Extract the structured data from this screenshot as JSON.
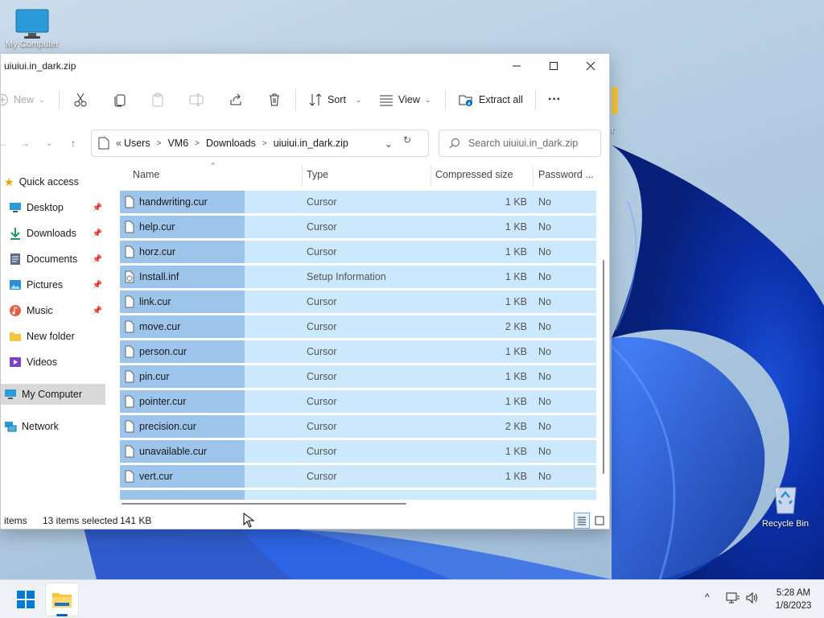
{
  "desktop": {
    "icons": [
      {
        "label": "My Computer"
      },
      {
        "label": "Recycle Bin"
      }
    ],
    "edge_letter": "r"
  },
  "window": {
    "title": "uiuiui.in_dark.zip",
    "controls": {
      "minimize": "—",
      "maximize": "☐",
      "close": "✕"
    }
  },
  "toolbar": {
    "new_label": "New",
    "sort_label": "Sort",
    "view_label": "View",
    "extract_label": "Extract all",
    "more_label": "···"
  },
  "address": {
    "prefix": "«",
    "crumbs": [
      "Users",
      "VM6",
      "Downloads",
      "uiuiui.in_dark.zip"
    ],
    "search_placeholder": "Search uiuiui.in_dark.zip"
  },
  "navpane": {
    "items": [
      {
        "label": "Quick access",
        "icon": "star-icon",
        "pinned": false
      },
      {
        "label": "Desktop",
        "icon": "desktop-icon",
        "pinned": true
      },
      {
        "label": "Downloads",
        "icon": "download-icon",
        "pinned": true
      },
      {
        "label": "Documents",
        "icon": "documents-icon",
        "pinned": true
      },
      {
        "label": "Pictures",
        "icon": "pictures-icon",
        "pinned": true
      },
      {
        "label": "Music",
        "icon": "music-icon",
        "pinned": true
      },
      {
        "label": "New folder",
        "icon": "folder-icon",
        "pinned": false
      },
      {
        "label": "Videos",
        "icon": "videos-icon",
        "pinned": false
      },
      {
        "label": "My Computer",
        "icon": "computer-icon",
        "pinned": false
      },
      {
        "label": "Network",
        "icon": "network-icon",
        "pinned": false
      }
    ]
  },
  "filelist": {
    "columns": [
      "Name",
      "Type",
      "Compressed size",
      "Password ..."
    ],
    "rows": [
      {
        "name": "handwriting.cur",
        "type": "Cursor",
        "size": "1 KB",
        "password": "No"
      },
      {
        "name": "help.cur",
        "type": "Cursor",
        "size": "1 KB",
        "password": "No"
      },
      {
        "name": "horz.cur",
        "type": "Cursor",
        "size": "1 KB",
        "password": "No"
      },
      {
        "name": "Install.inf",
        "type": "Setup Information",
        "size": "1 KB",
        "password": "No"
      },
      {
        "name": "link.cur",
        "type": "Cursor",
        "size": "1 KB",
        "password": "No"
      },
      {
        "name": "move.cur",
        "type": "Cursor",
        "size": "2 KB",
        "password": "No"
      },
      {
        "name": "person.cur",
        "type": "Cursor",
        "size": "1 KB",
        "password": "No"
      },
      {
        "name": "pin.cur",
        "type": "Cursor",
        "size": "1 KB",
        "password": "No"
      },
      {
        "name": "pointer.cur",
        "type": "Cursor",
        "size": "1 KB",
        "password": "No"
      },
      {
        "name": "precision.cur",
        "type": "Cursor",
        "size": "2 KB",
        "password": "No"
      },
      {
        "name": "unavailable.cur",
        "type": "Cursor",
        "size": "1 KB",
        "password": "No"
      },
      {
        "name": "vert.cur",
        "type": "Cursor",
        "size": "1 KB",
        "password": "No"
      }
    ]
  },
  "status": {
    "items": "items",
    "selected": "13 items selected",
    "size": "141 KB"
  },
  "taskbar": {
    "time": "5:28 AM",
    "date": "1/8/2023"
  },
  "colors": {
    "accent": "#0067c0",
    "selection_row": "#cce8fd",
    "selection_name": "#9dc4ea"
  }
}
